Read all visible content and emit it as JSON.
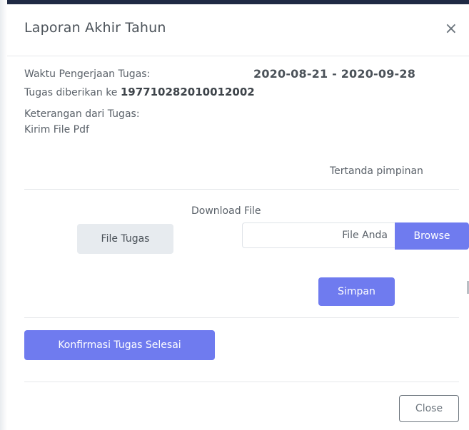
{
  "modal": {
    "title": "Laporan Akhir Tahun",
    "close_symbol": "×"
  },
  "task": {
    "time_label": "Waktu Pengerjaan Tugas:",
    "date_range": "2020-08-21 - 2020-09-28",
    "assigned_prefix": "Tugas diberikan ke",
    "assigned_id": "197710282010012002",
    "note_label": "Keterangan dari Tugas:",
    "note_value": "Kirim File Pdf",
    "signed": "Tertanda pimpinan"
  },
  "files": {
    "download_label": "Download File",
    "file_button": "File Tugas",
    "input_text": "File Anda",
    "browse_label": "Browse",
    "save_label": "Simpan"
  },
  "actions": {
    "confirm_label": "Konfirmasi Tugas Selesai",
    "close_label": "Close"
  },
  "colors": {
    "primary": "#6f7bef",
    "muted_bg": "#e7ebef",
    "top_strip": "#1f2a44"
  },
  "icons": {
    "close": "close-icon"
  }
}
